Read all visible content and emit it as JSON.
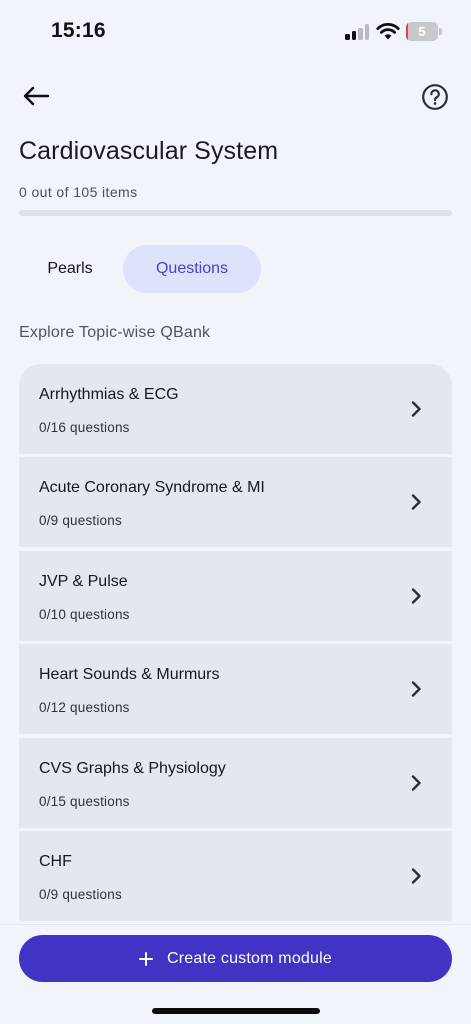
{
  "status_bar": {
    "time": "15:16",
    "battery_level": "5",
    "battery_fraction": 0.05,
    "signal_bars_active": 2,
    "signal_bars_total": 4,
    "icons": [
      "cellular-signal-icon",
      "wifi-icon",
      "battery-icon"
    ]
  },
  "header": {
    "back_icon": "arrow-left-icon",
    "help_icon": "question-circle-icon"
  },
  "page": {
    "title": "Cardiovascular System",
    "progress_text": "0 out of 105 items",
    "progress_completed": 0,
    "progress_total": 105
  },
  "tabs": [
    {
      "label": "Pearls",
      "active": false
    },
    {
      "label": "Questions",
      "active": true
    }
  ],
  "section_label": "Explore Topic-wise QBank",
  "topics": [
    {
      "name": "Arrhythmias & ECG",
      "count": "0/16 questions"
    },
    {
      "name": "Acute Coronary Syndrome & MI",
      "count": "0/9 questions"
    },
    {
      "name": "JVP & Pulse",
      "count": "0/10 questions"
    },
    {
      "name": "Heart Sounds & Murmurs",
      "count": "0/12 questions"
    },
    {
      "name": "CVS Graphs & Physiology",
      "count": "0/15 questions"
    },
    {
      "name": "CHF",
      "count": "0/9 questions"
    }
  ],
  "create_button": {
    "label": "Create custom module",
    "icon": "plus-icon"
  },
  "colors": {
    "accent": "#4333c4",
    "tab_active_bg": "#dfe2fb",
    "tab_active_text": "#4b3fc0",
    "card_bg": "#e3e7ee",
    "page_bg": "#f1f4fa",
    "battery_low": "#e0473d"
  }
}
